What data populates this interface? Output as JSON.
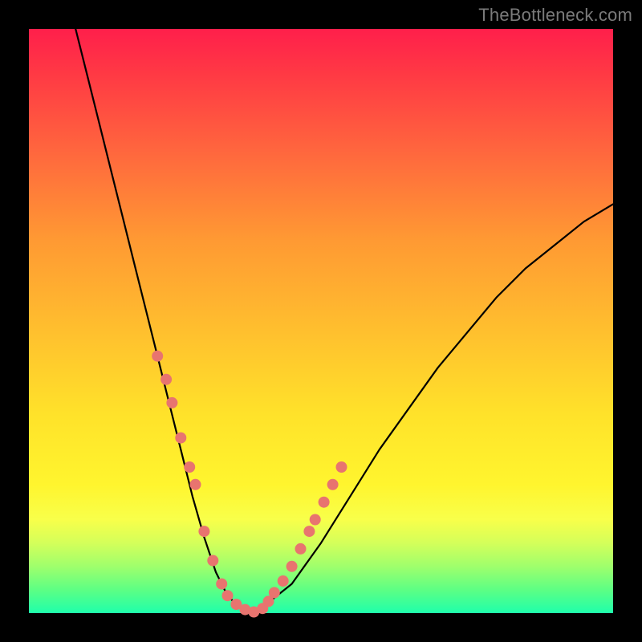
{
  "watermark": "TheBottleneck.com",
  "chart_data": {
    "type": "line",
    "title": "",
    "xlabel": "",
    "ylabel": "",
    "xlim": [
      0,
      100
    ],
    "ylim": [
      0,
      100
    ],
    "series": [
      {
        "name": "bottleneck-curve",
        "x": [
          8,
          10,
          12,
          14,
          16,
          18,
          20,
          22,
          24,
          26,
          28,
          30,
          32,
          34,
          36,
          38,
          40,
          45,
          50,
          55,
          60,
          65,
          70,
          75,
          80,
          85,
          90,
          95,
          100
        ],
        "values": [
          100,
          92,
          84,
          76,
          68,
          60,
          52,
          44,
          36,
          28,
          20,
          13,
          7,
          3,
          1,
          0,
          1,
          5,
          12,
          20,
          28,
          35,
          42,
          48,
          54,
          59,
          63,
          67,
          70
        ]
      }
    ],
    "markers": {
      "name": "data-points",
      "x": [
        22.0,
        23.5,
        24.5,
        26.0,
        27.5,
        28.5,
        30.0,
        31.5,
        33.0,
        34.0,
        35.5,
        37.0,
        38.5,
        40.0,
        41.0,
        42.0,
        43.5,
        45.0,
        46.5,
        48.0,
        49.0,
        50.5,
        52.0,
        53.5
      ],
      "y": [
        44,
        40,
        36,
        30,
        25,
        22,
        14,
        9,
        5,
        3,
        1.5,
        0.6,
        0.2,
        0.8,
        2,
        3.5,
        5.5,
        8,
        11,
        14,
        16,
        19,
        22,
        25
      ]
    },
    "colors": {
      "curve": "#000000",
      "marker": "#e8746f"
    }
  }
}
